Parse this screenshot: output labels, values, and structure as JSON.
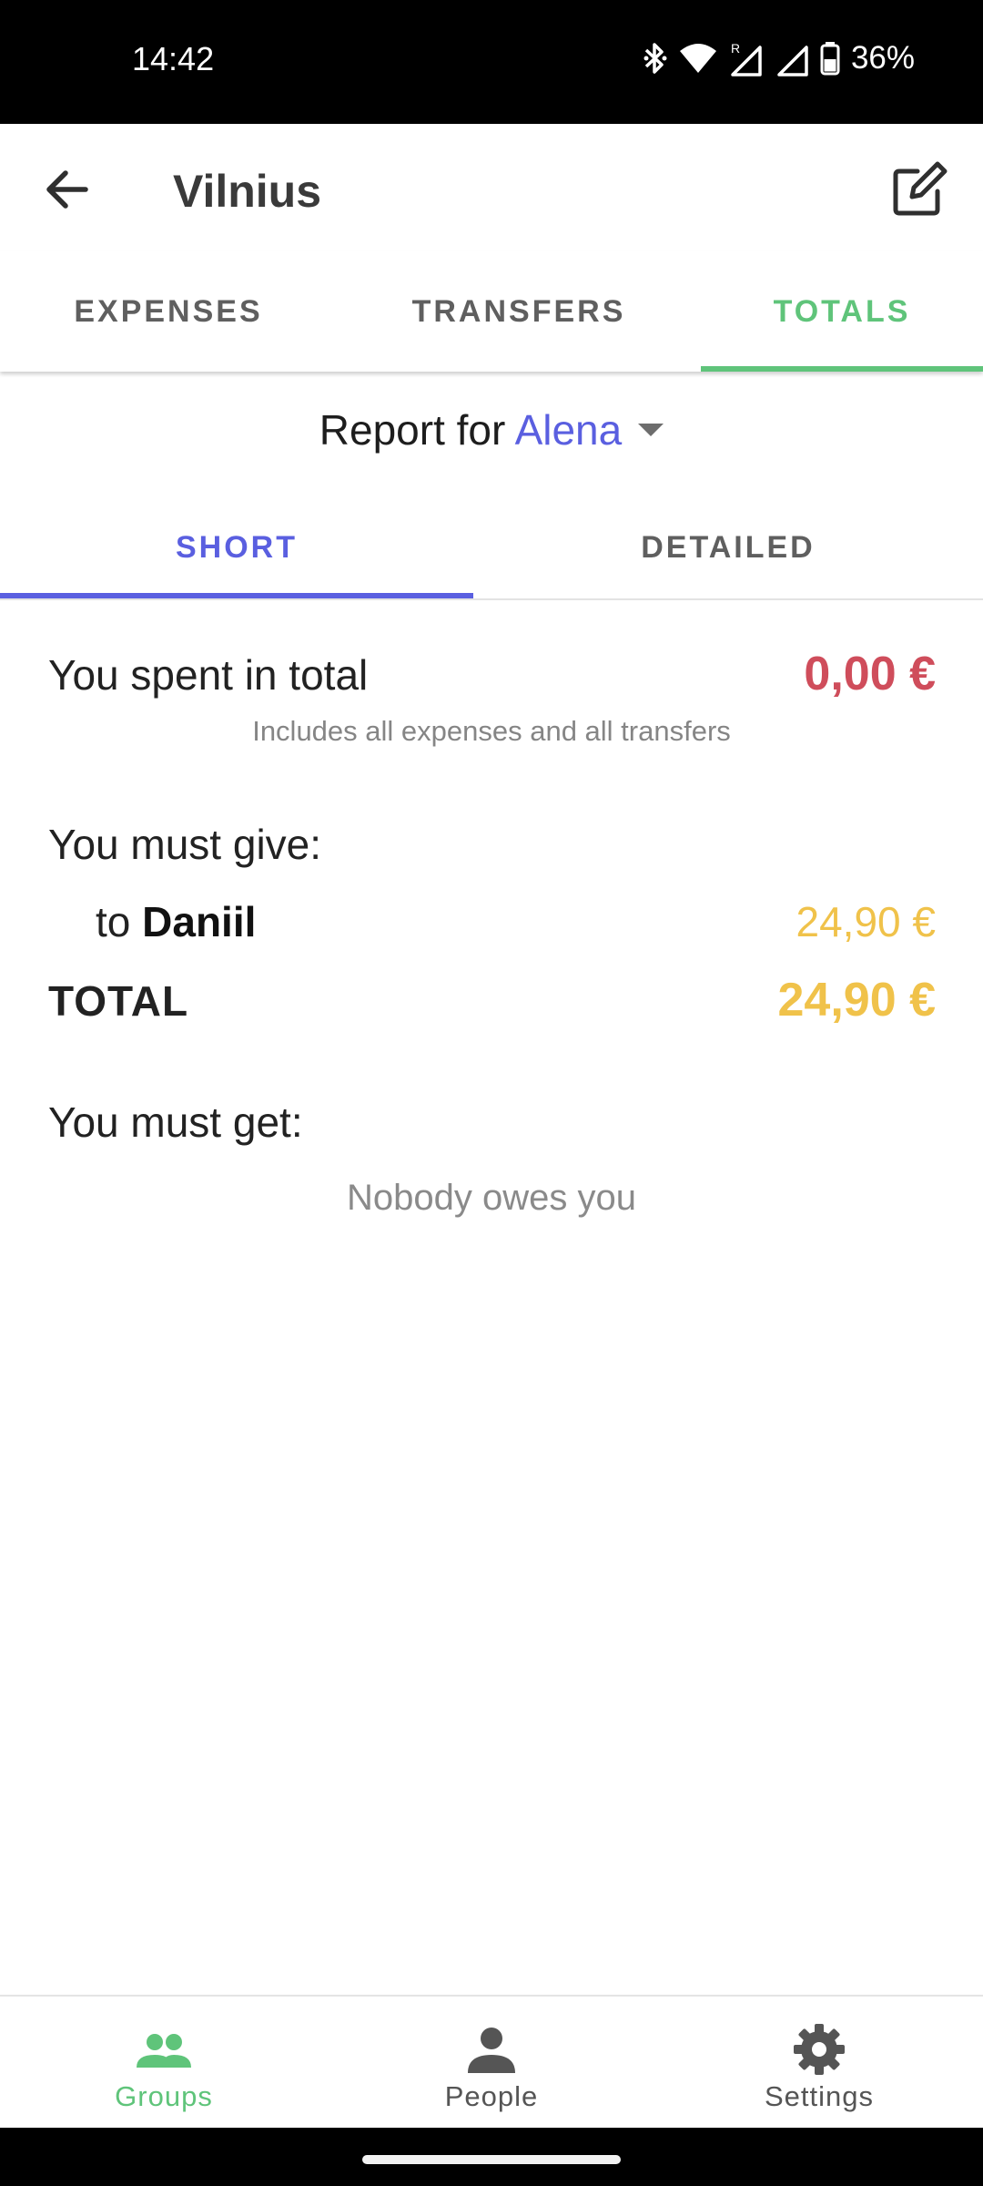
{
  "status_bar": {
    "time": "14:42",
    "battery_percent": "36%",
    "icons": [
      "bluetooth-icon",
      "wifi-icon",
      "signal-roaming-icon",
      "signal-icon",
      "battery-icon"
    ]
  },
  "app_bar": {
    "title": "Vilnius",
    "back_icon": "arrow-left-icon",
    "edit_icon": "edit-icon"
  },
  "tabs": [
    {
      "label": "EXPENSES",
      "selected": false
    },
    {
      "label": "TRANSFERS",
      "selected": false
    },
    {
      "label": "TOTALS",
      "selected": true
    }
  ],
  "report": {
    "prefix": "Report for",
    "person": "Alena"
  },
  "subtabs": [
    {
      "label": "SHORT",
      "selected": true
    },
    {
      "label": "DETAILED",
      "selected": false
    }
  ],
  "summary": {
    "spent_label": "You spent in total",
    "spent_amount": "0,00 €",
    "spent_note": "Includes all expenses and all transfers",
    "give_title": "You must give:",
    "give_items": [
      {
        "prefix": "to",
        "name": "Daniil",
        "amount": "24,90 €"
      }
    ],
    "total_label": "TOTAL",
    "total_amount": "24,90 €",
    "get_title": "You must get:",
    "get_empty": "Nobody owes you"
  },
  "bottom_nav": [
    {
      "label": "Groups",
      "icon": "groups-icon",
      "selected": true
    },
    {
      "label": "People",
      "icon": "person-icon",
      "selected": false
    },
    {
      "label": "Settings",
      "icon": "gear-icon",
      "selected": false
    }
  ],
  "colors": {
    "accent_green": "#5fc47a",
    "accent_blue": "#5a5fe0",
    "negative_red": "#cf4d5b",
    "owe_yellow": "#f0c24a"
  }
}
